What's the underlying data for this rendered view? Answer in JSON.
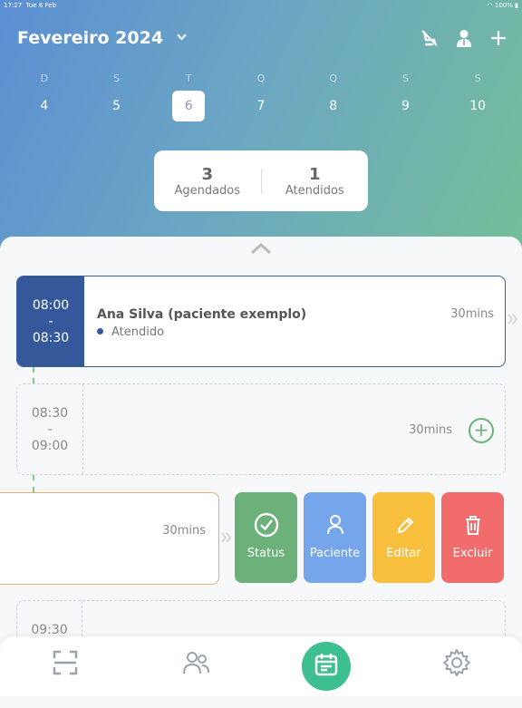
{
  "status_bar": {
    "time": "17:27",
    "date": "Tue 6 Feb",
    "battery": "100%"
  },
  "header": {
    "month_title": "Fevereiro 2024"
  },
  "week": [
    {
      "letter": "D",
      "number": "4"
    },
    {
      "letter": "S",
      "number": "5"
    },
    {
      "letter": "T",
      "number": "6",
      "selected": true
    },
    {
      "letter": "Q",
      "number": "7"
    },
    {
      "letter": "Q",
      "number": "8"
    },
    {
      "letter": "S",
      "number": "9"
    },
    {
      "letter": "S",
      "number": "10"
    }
  ],
  "summary": {
    "scheduled_count": "3",
    "scheduled_label": "Agendados",
    "attended_count": "1",
    "attended_label": "Atendidos"
  },
  "appointments": [
    {
      "start": "08:00",
      "sep": "-",
      "end": "08:30",
      "patient": "Ana Silva (paciente exemplo)",
      "status": "Atendido",
      "duration": "30mins"
    },
    {
      "start": "08:30",
      "sep": "-",
      "end": "09:00",
      "duration": "30mins"
    },
    {
      "duration": "30mins"
    },
    {
      "start": "09:30"
    }
  ],
  "actions": [
    {
      "label": "Status",
      "icon": "check-circle-icon",
      "color": "#6db17a"
    },
    {
      "label": "Paciente",
      "icon": "person-icon",
      "color": "#75a5ea"
    },
    {
      "label": "Editar",
      "icon": "pencil-icon",
      "color": "#f8bf3c"
    },
    {
      "label": "Excluir",
      "icon": "trash-icon",
      "color": "#f26c6c"
    }
  ],
  "colors": {
    "accent": "#34589a",
    "primary_green": "#3ebf8f"
  }
}
